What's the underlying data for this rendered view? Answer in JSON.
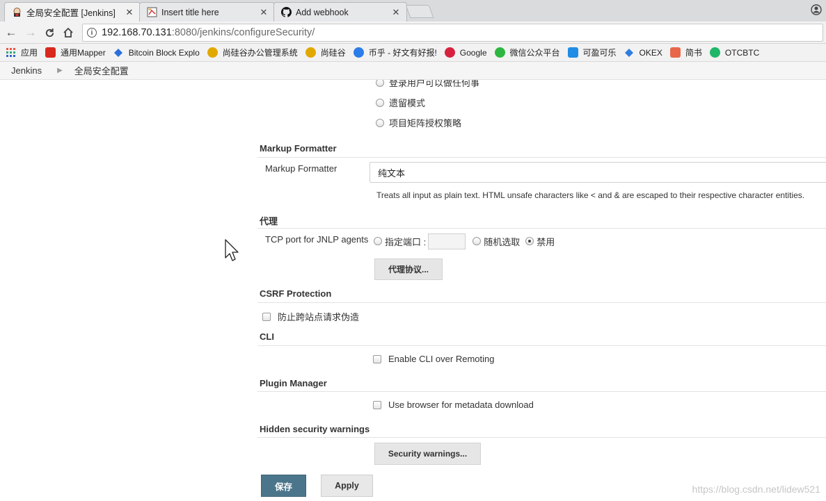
{
  "tabs": [
    {
      "label": "全局安全配置 [Jenkins]",
      "active": true,
      "icon": "jenkins-icon"
    },
    {
      "label": "Insert title here",
      "active": false,
      "icon": "eclipse-icon"
    },
    {
      "label": "Add webhook",
      "active": false,
      "icon": "github-icon"
    }
  ],
  "address": {
    "host": "192.168.70.131",
    "path": ":8080/jenkins/configureSecurity/"
  },
  "bookmarks": [
    {
      "label": "应用",
      "icon": "apps-grid-icon",
      "color": "#e8a33d"
    },
    {
      "label": "通用Mapper",
      "icon": "gitee-icon",
      "color": "#d9281c"
    },
    {
      "label": "Bitcoin Block Explo",
      "icon": "blockchain-icon",
      "color": "#2a6fdb"
    },
    {
      "label": "尚硅谷办公管理系统",
      "icon": "atguigu-icon",
      "color": "#e1a800"
    },
    {
      "label": "尚硅谷",
      "icon": "atguigu-icon",
      "color": "#e1a800"
    },
    {
      "label": "币乎 - 好文有好报!",
      "icon": "bihu-icon",
      "color": "#2b7de9"
    },
    {
      "label": "Google",
      "icon": "pinterest-icon",
      "color": "#d6223f"
    },
    {
      "label": "微信公众平台",
      "icon": "wechat-icon",
      "color": "#2db742"
    },
    {
      "label": "可盈可乐",
      "icon": "keying-icon",
      "color": "#1f8de5"
    },
    {
      "label": "OKEX",
      "icon": "okex-icon",
      "color": "#2f7de1"
    },
    {
      "label": "简书",
      "icon": "jianshu-icon",
      "color": "#e8674b"
    },
    {
      "label": "OTCBTC",
      "icon": "otcbtc-icon",
      "color": "#20b66a"
    }
  ],
  "breadcrumb": {
    "root": "Jenkins",
    "current": "全局安全配置"
  },
  "authorization": {
    "partial_option": "登录用户可以做任何事",
    "options": [
      "遗留模式",
      "项目矩阵授权策略"
    ]
  },
  "markup": {
    "title": "Markup Formatter",
    "label": "Markup Formatter",
    "value": "纯文本",
    "help": "Treats all input as plain text. HTML unsafe characters like < and & are escaped to their respective character entities."
  },
  "proxy": {
    "title": "代理",
    "label": "TCP port for JNLP agents",
    "fixed": "指定端口 :",
    "random": "随机选取",
    "disable": "禁用",
    "selected": "disable",
    "protocols_button": "代理协议..."
  },
  "csrf": {
    "title": "CSRF Protection",
    "checkbox": "防止跨站点请求伪造"
  },
  "cli": {
    "title": "CLI",
    "checkbox": "Enable CLI over Remoting"
  },
  "plugin_manager": {
    "title": "Plugin Manager",
    "checkbox": "Use browser for metadata download"
  },
  "hidden_warnings": {
    "title": "Hidden security warnings",
    "button": "Security warnings..."
  },
  "actions": {
    "save": "保存",
    "apply": "Apply"
  },
  "watermark": "https://blog.csdn.net/lidew521"
}
